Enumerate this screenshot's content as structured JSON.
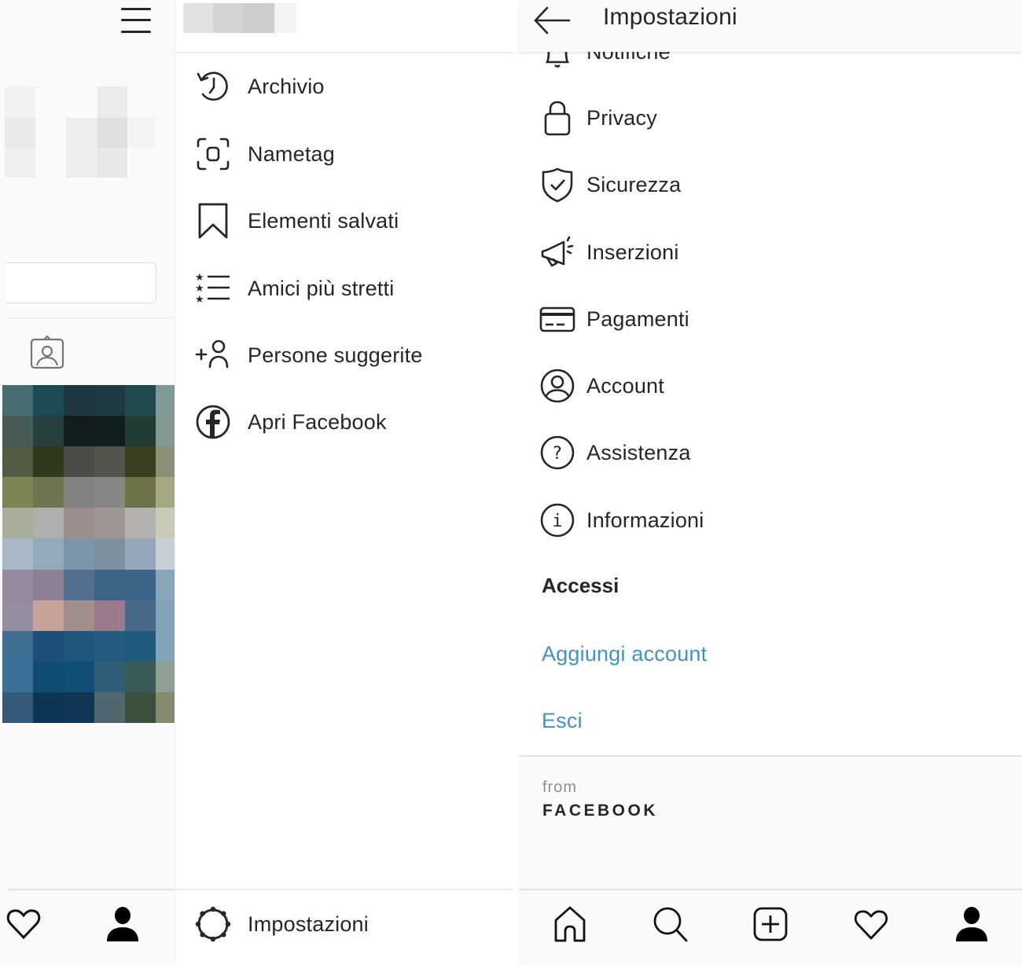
{
  "profile_strip": {
    "blurred_header_colors": [
      "#f2f2f2",
      "#eeeeee",
      "#f4f4f4",
      "#ececec",
      "#e3e3e3",
      "#f1f1f1"
    ],
    "photo_mosaic_colors": [
      [
        "#466d72",
        "#1c4a55",
        "#1e3740",
        "#1f3a42",
        "#214a4f",
        "#7e9996"
      ],
      [
        "#485a56",
        "#27403d",
        "#111d1e",
        "#121e1e",
        "#223b33",
        "#849893"
      ],
      [
        "#535c43",
        "#2e3a1d",
        "#4a4c48",
        "#51544a",
        "#3a4120",
        "#8e8f78"
      ],
      [
        "#7c8654",
        "#6d7650",
        "#828180",
        "#878685",
        "#6d7347",
        "#a6a883"
      ],
      [
        "#a9ae9a",
        "#adb0ac",
        "#9b8e8d",
        "#a09595",
        "#b3b2ae",
        "#c8c9b7"
      ],
      [
        "#a8b8c6",
        "#93aabd",
        "#7d95a9",
        "#7e90a0",
        "#94a7b8",
        "#c6cfd6"
      ],
      [
        "#958aa0",
        "#8d7f95",
        "#526f8f",
        "#3c6588",
        "#3c6486",
        "#8aa6bb"
      ],
      [
        "#968c9f",
        "#c9a19b",
        "#a18f8c",
        "#9a7a8c",
        "#466a88",
        "#83a3b9"
      ],
      [
        "#3e6e90",
        "#1d4e78",
        "#21557b",
        "#245a7e",
        "#1f5a7d",
        "#7fa3b8"
      ],
      [
        "#3a7097",
        "#104b73",
        "#124d75",
        "#2f5e78",
        "#3a5a55",
        "#8e9f93"
      ],
      [
        "#35597a",
        "#0d3555",
        "#0f3656",
        "#51676f",
        "#3b503d",
        "#838a6e"
      ]
    ],
    "icons": {
      "menu": "hamburger-menu-icon",
      "tagged": "tagged-photos-icon",
      "heart": "heart-icon",
      "profile": "profile-icon"
    }
  },
  "drawer": {
    "username_blur_colors": [
      "#e2e2e2",
      "#d4d4d4",
      "#cecece",
      "#f4f4f4"
    ],
    "items": [
      {
        "label": "Archivio",
        "icon": "archive-history-icon"
      },
      {
        "label": "Nametag",
        "icon": "nametag-icon"
      },
      {
        "label": "Elementi salvati",
        "icon": "bookmark-icon"
      },
      {
        "label": "Amici più stretti",
        "icon": "close-friends-list-icon"
      },
      {
        "label": "Persone suggerite",
        "icon": "add-person-icon"
      },
      {
        "label": "Apri Facebook",
        "icon": "facebook-icon"
      }
    ],
    "settings": {
      "label": "Impostazioni",
      "icon": "settings-gear-icon"
    }
  },
  "settings": {
    "header": {
      "title": "Impostazioni",
      "back_icon": "back-arrow-icon"
    },
    "partial_item": {
      "label": "Notifiche",
      "icon": "bell-icon"
    },
    "items": [
      {
        "label": "Privacy",
        "icon": "lock-icon"
      },
      {
        "label": "Sicurezza",
        "icon": "shield-check-icon"
      },
      {
        "label": "Inserzioni",
        "icon": "megaphone-icon"
      },
      {
        "label": "Pagamenti",
        "icon": "credit-card-icon"
      },
      {
        "label": "Account",
        "icon": "account-circle-icon"
      },
      {
        "label": "Assistenza",
        "icon": "help-circle-icon"
      },
      {
        "label": "Informazioni",
        "icon": "info-circle-icon"
      }
    ],
    "section_title": "Accessi",
    "links": [
      {
        "label": "Aggiungi account"
      },
      {
        "label": "Esci"
      }
    ],
    "link_color": "#3f93c8",
    "footer": {
      "from": "from",
      "brand": "FACEBOOK"
    },
    "bottom_nav": [
      {
        "name": "home",
        "icon": "home-icon"
      },
      {
        "name": "search",
        "icon": "search-icon"
      },
      {
        "name": "new-post",
        "icon": "add-post-icon"
      },
      {
        "name": "activity",
        "icon": "heart-icon"
      },
      {
        "name": "profile",
        "icon": "profile-icon"
      }
    ]
  }
}
